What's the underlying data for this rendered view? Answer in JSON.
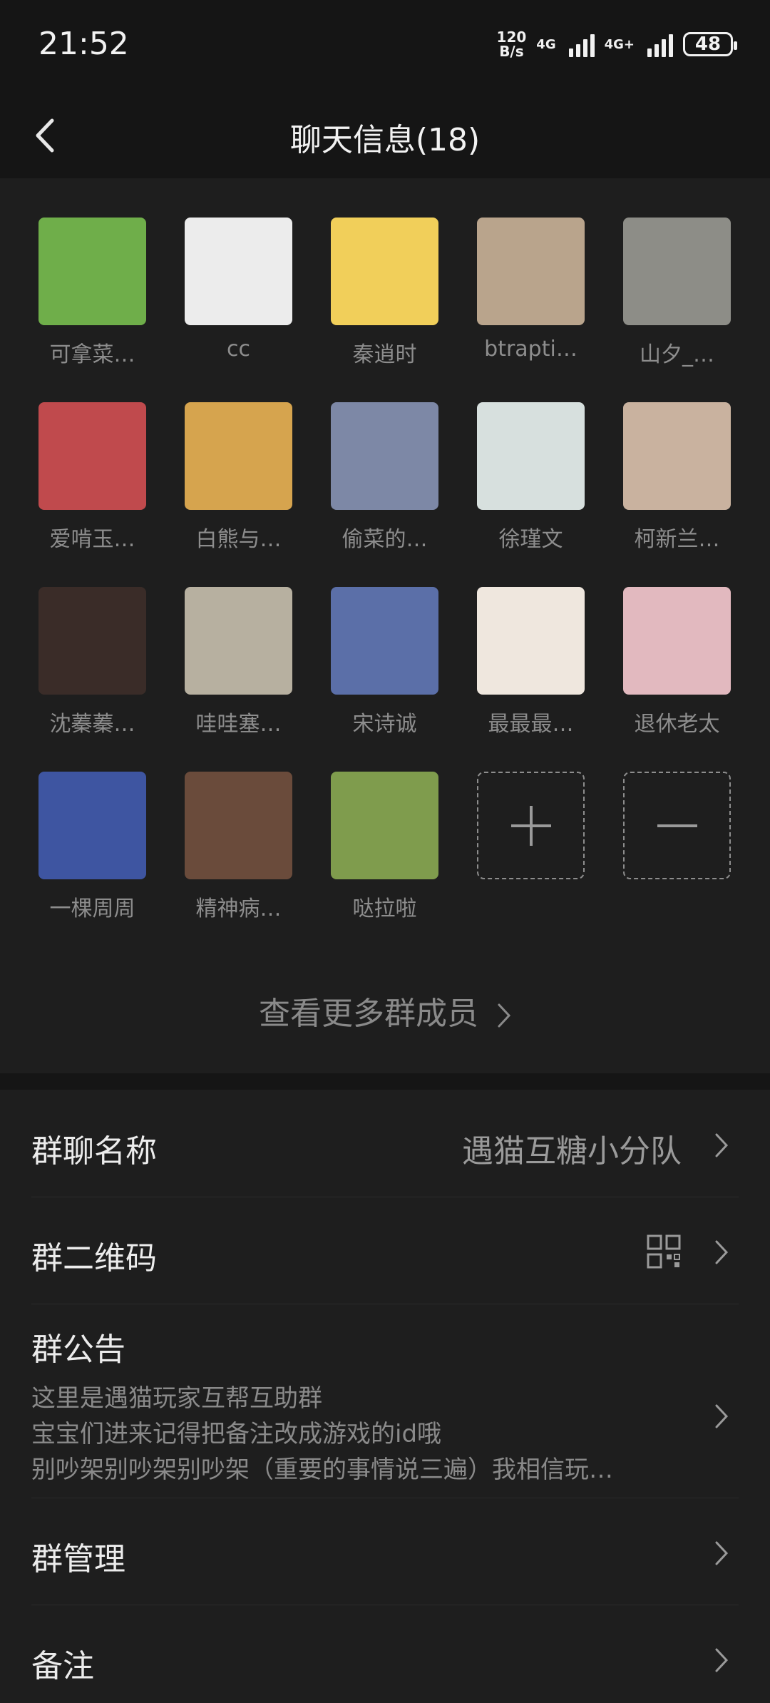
{
  "status_bar": {
    "time": "21:52",
    "speed_value": "120",
    "speed_unit": "B/s",
    "net1": "4G",
    "net2": "4G+",
    "battery": "48"
  },
  "header": {
    "title": "聊天信息(18)"
  },
  "members": [
    {
      "name": "可拿菜…",
      "color": "#6fae4a"
    },
    {
      "name": "cc",
      "color": "#ececec"
    },
    {
      "name": "秦逍时",
      "color": "#f1cf5a"
    },
    {
      "name": "btrapti…",
      "color": "#b9a48c"
    },
    {
      "name": "山夕_…",
      "color": "#8d8d87"
    },
    {
      "name": "爱啃玉…",
      "color": "#c04a4d"
    },
    {
      "name": "白熊与…",
      "color": "#d6a44e"
    },
    {
      "name": "偷菜的…",
      "color": "#7d88a6"
    },
    {
      "name": "徐瑾文",
      "color": "#d7e0de"
    },
    {
      "name": "柯新兰…",
      "color": "#c9b29f"
    },
    {
      "name": "沈蓁蓁…",
      "color": "#3a2c28"
    },
    {
      "name": "哇哇塞…",
      "color": "#b7b0a0"
    },
    {
      "name": "宋诗诚",
      "color": "#5b6fa8"
    },
    {
      "name": "最最最…",
      "color": "#efe7de"
    },
    {
      "name": "退休老太",
      "color": "#e2b9bf"
    },
    {
      "name": "一棵周周",
      "color": "#3e55a1"
    },
    {
      "name": "精神病…",
      "color": "#6a4b3b"
    },
    {
      "name": "哒拉啦",
      "color": "#7f9c4d"
    }
  ],
  "view_more": "查看更多群成员",
  "settings": {
    "group_name_label": "群聊名称",
    "group_name_value": "遇猫互糖小分队",
    "qr_label": "群二维码",
    "notice_label": "群公告",
    "notice_lines": [
      "这里是遇猫玩家互帮互助群",
      "宝宝们进来记得把备注改成游戏的id哦",
      "别吵架别吵架别吵架（重要的事情说三遍）我相信玩…"
    ],
    "manage_label": "群管理",
    "remark_label": "备注"
  }
}
